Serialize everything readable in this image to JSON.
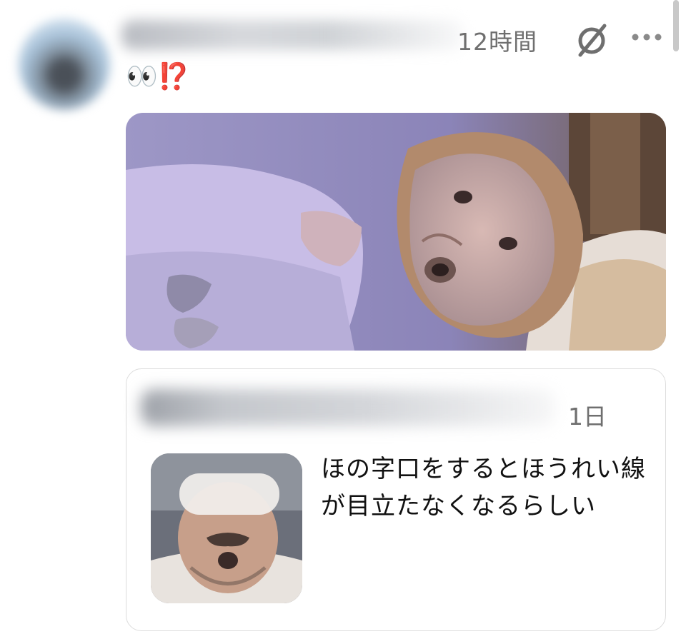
{
  "post": {
    "avatar_icon": "user-avatar-blurred",
    "timestamp": "12時間",
    "action_icon": "edit-off-icon",
    "more_icon": "more-horizontal-icon",
    "text": "👀⁉️",
    "media": {
      "type": "image"
    }
  },
  "quote": {
    "timestamp": "1日",
    "text": "ほの字口をするとほうれい線が目立たなくなるらしい",
    "thumbnail": {
      "type": "image"
    }
  },
  "colors": {
    "meta_text": "#6f6f6f",
    "body_text": "#111111",
    "card_border": "#dcdcdc",
    "accent_red": "#d62a1e"
  }
}
